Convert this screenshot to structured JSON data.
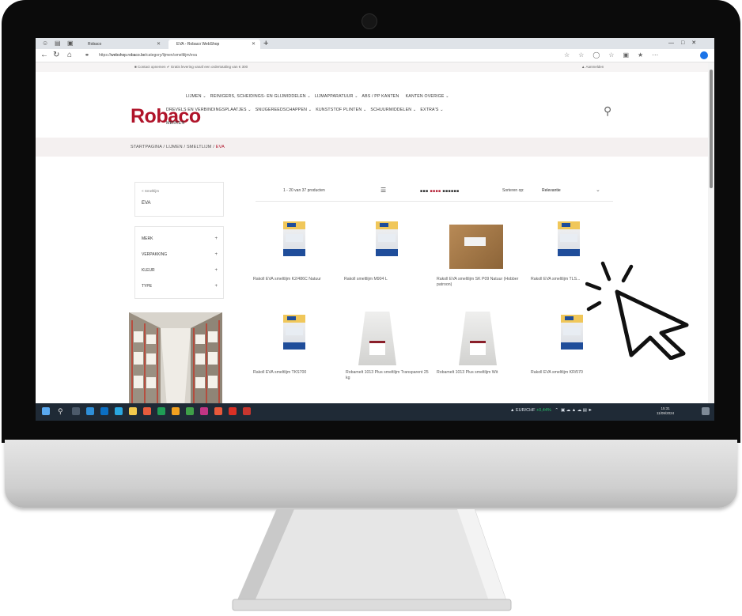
{
  "browser": {
    "tabs": [
      {
        "label": "Robaco"
      },
      {
        "label": "EVA - Robaco WebShop"
      }
    ],
    "new_tab": "+",
    "url_prefix": "https://",
    "url_host": "webshop.robaco.be",
    "url_path": "/category/lijmen/smeltlijm/eva"
  },
  "site": {
    "topbar": {
      "contact": "■ Contact opnemen   ✔ Gratis levering vanaf een ordertotaling van € 300",
      "login": "▲ Aanmelden"
    },
    "logo": "Robaco",
    "menu": {
      "row1": [
        "LIJMEN",
        "REINIGERS, SCHEIDINGS- EN GLIJMIDDELEN",
        "LIJMAPPARATUUR",
        "ABS / PP KANTEN",
        "KANTEN OVERIGE"
      ],
      "row2": [
        "DREVELS EN VERBINDINGSPLAATJES",
        "SNIJGEREEDSCHAPPEN",
        "KUNSTSTOF PLINTEN",
        "SCHUURMIDDELEN",
        "EXTRA'S"
      ],
      "row3": [
        "MERKEN"
      ]
    },
    "breadcrumb": {
      "home": "STARTPAGINA",
      "level1": "LIJMEN",
      "level2": "SMELTLIJM",
      "current": "EVA",
      "sep": " / "
    },
    "sidebar": {
      "back_link": "< Smeltlijm",
      "category": "EVA",
      "filters": [
        "MERK",
        "VERPAKKING",
        "KLEUR",
        "TYPE"
      ],
      "plus": "+"
    },
    "results": {
      "count": "1 - 20 van 37 producten",
      "sort_label": "Sorteren op:",
      "sort_value": "Relevantie"
    },
    "products": [
      {
        "name": "Rakoll EVA smeltlijm K2/486C Natuur"
      },
      {
        "name": "Rakoll smeltlijm M904 L"
      },
      {
        "name": "Rakoll EVA smeltlijm SK P09 Natuur (Hobber patroon)"
      },
      {
        "name": "Rakoll EVA smeltlijm TLS..."
      },
      {
        "name": "Rakoll EVA smeltlijm TKS700"
      },
      {
        "name": "Robamelt 1013 Plus smeltlijm Transparent 25 kg"
      },
      {
        "name": "Robamelt 1013 Plus smeltlijm Wit"
      },
      {
        "name": "Rakoll EVA smeltlijm KR/570"
      }
    ]
  },
  "taskbar": {
    "ticker": "EUR/CHF",
    "ticker_change": "+0,44%",
    "time": "15:31",
    "date": "11/09/2024"
  },
  "colors": {
    "brand": "#b0142a",
    "taskbar": "#1f2a36"
  }
}
